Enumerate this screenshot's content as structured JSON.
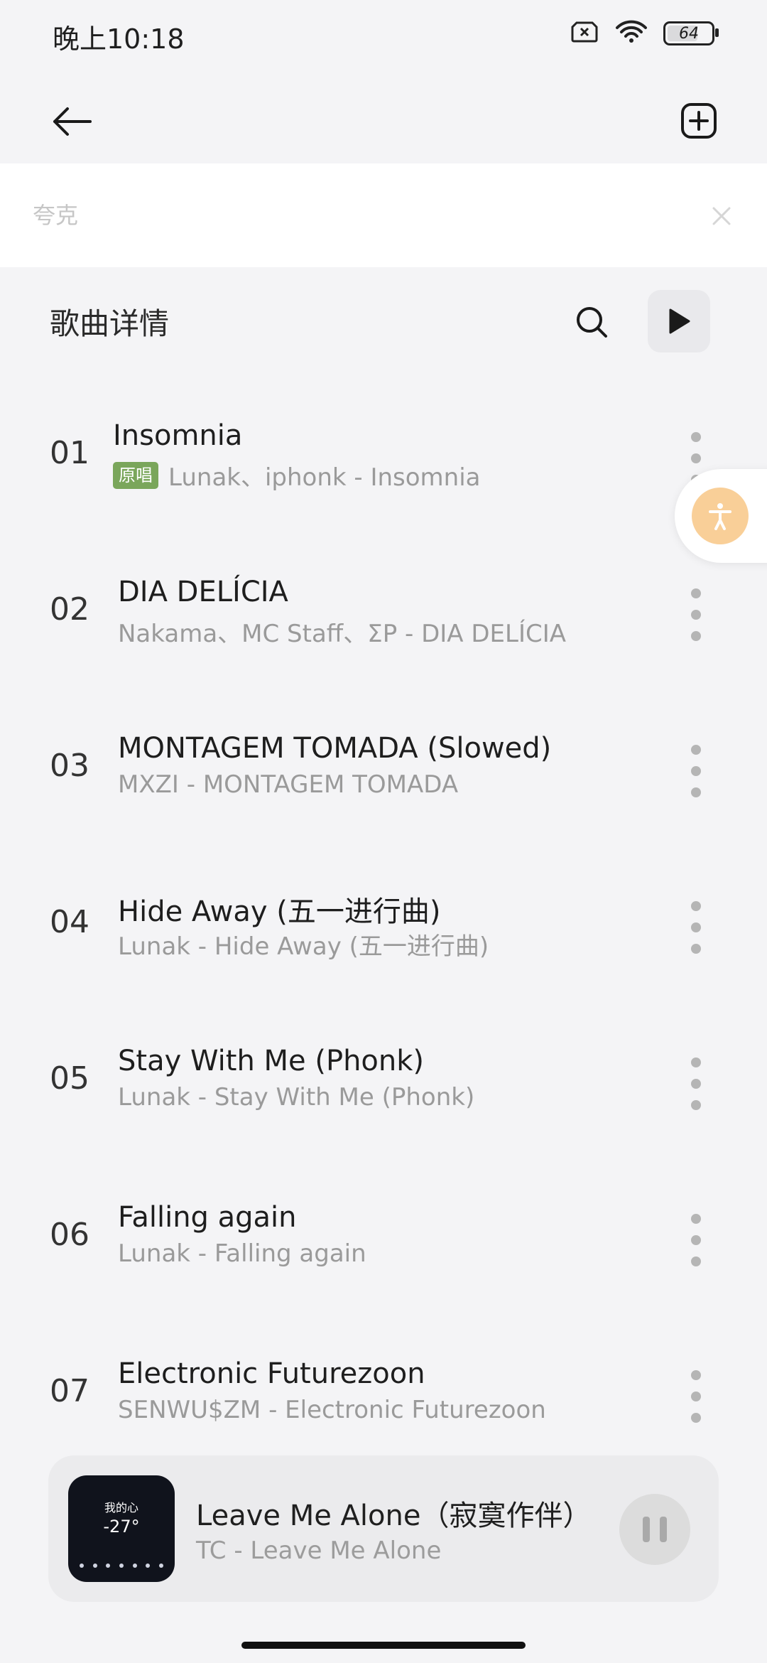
{
  "status_bar": {
    "time": "晚上10:18",
    "battery": "64"
  },
  "search": {
    "value": "",
    "placeholder": "夸克"
  },
  "section": {
    "title": "歌曲详情"
  },
  "songs": [
    {
      "index": "01",
      "title": "Insomnia",
      "badge": "原唱",
      "subtitle": "Lunak、iphonk - Insomnia"
    },
    {
      "index": "02",
      "title": "DIA DELÍCIA",
      "subtitle": "Nakama、MC Staff、ΣP - DIA DELÍCIA"
    },
    {
      "index": "03",
      "title": "MONTAGEM TOMADA (Slowed)",
      "subtitle": "MXZI - MONTAGEM TOMADA"
    },
    {
      "index": "04",
      "title": "Hide Away (五一进行曲)",
      "subtitle": "Lunak - Hide Away (五一进行曲)"
    },
    {
      "index": "05",
      "title": "Stay With Me (Phonk)",
      "subtitle": "Lunak - Stay With Me (Phonk)"
    },
    {
      "index": "06",
      "title": "Falling again",
      "subtitle": "Lunak - Falling again"
    },
    {
      "index": "07",
      "title": "Electronic Futurezoon",
      "subtitle": "SENWU$ZM - Electronic Futurezoon"
    }
  ],
  "now_playing": {
    "title": "Leave Me Alone（寂寞作伴）",
    "subtitle": "TC - Leave Me Alone",
    "cover_text_1": "我的心",
    "cover_text_2": "-27°"
  },
  "colors": {
    "accent_badge": "#7aa65b",
    "accessibility_fab": "#f9cf98"
  },
  "icons": [
    "back-arrow-icon",
    "add-square-icon",
    "clear-x-icon",
    "search-icon",
    "play-icon",
    "more-vertical-icon",
    "accessibility-icon",
    "pause-icon"
  ]
}
